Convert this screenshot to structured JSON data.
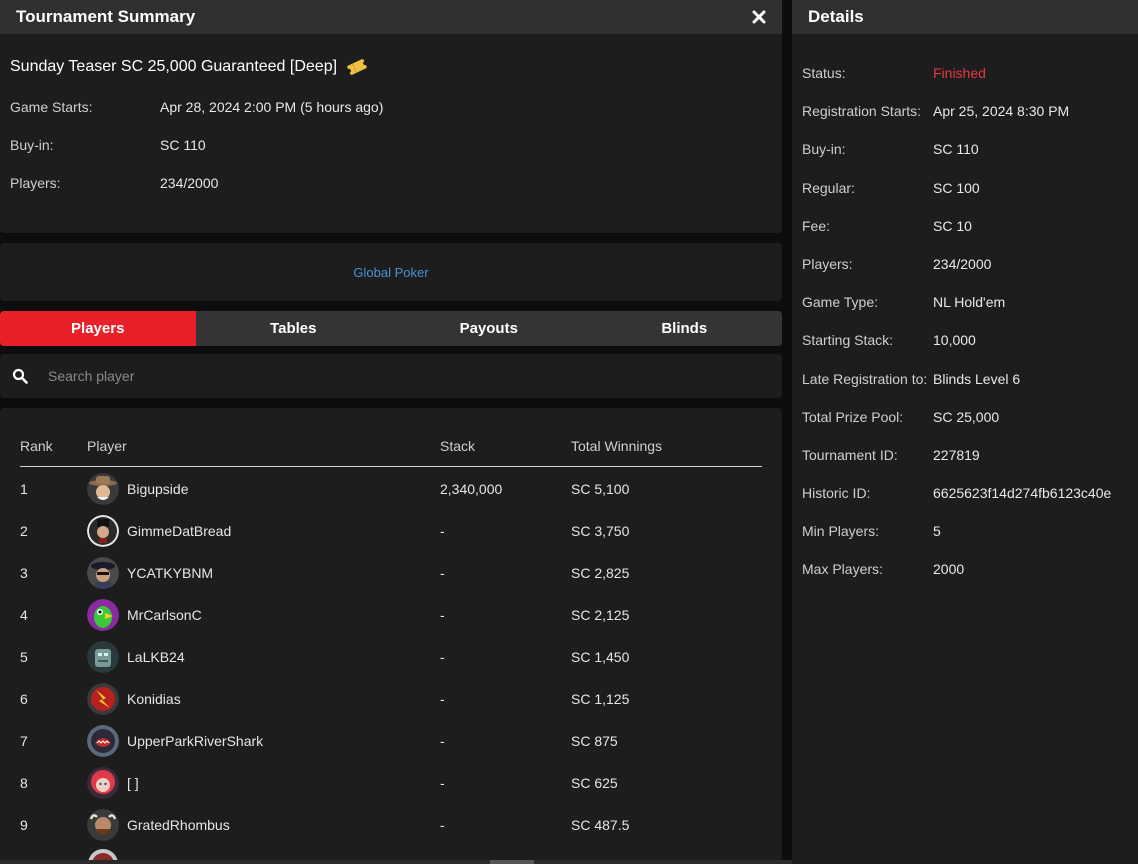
{
  "summary": {
    "title": "Tournament Summary",
    "name": "Sunday Teaser SC 25,000 Guaranteed [Deep]",
    "rows": [
      {
        "label": "Game Starts:",
        "value": "Apr 28, 2024 2:00 PM (5 hours ago)"
      },
      {
        "label": "Buy-in:",
        "value": "SC 110"
      },
      {
        "label": "Players:",
        "value": "234/2000"
      }
    ]
  },
  "site": {
    "link": "Global Poker"
  },
  "tabs": [
    {
      "label": "Players",
      "active": true
    },
    {
      "label": "Tables",
      "active": false
    },
    {
      "label": "Payouts",
      "active": false
    },
    {
      "label": "Blinds",
      "active": false
    }
  ],
  "search": {
    "placeholder": "Search player"
  },
  "table": {
    "headers": {
      "rank": "Rank",
      "player": "Player",
      "stack": "Stack",
      "winnings": "Total Winnings"
    },
    "rows": [
      {
        "rank": "1",
        "player": "Bigupside",
        "stack": "2,340,000",
        "winnings": "SC 5,100",
        "avatar": "cowboy-avatar"
      },
      {
        "rank": "2",
        "player": "GimmeDatBread",
        "stack": "-",
        "winnings": "SC 3,750",
        "avatar": "gentleman-avatar"
      },
      {
        "rank": "3",
        "player": "YCATKYBNM",
        "stack": "-",
        "winnings": "SC 2,825",
        "avatar": "gangster-avatar"
      },
      {
        "rank": "4",
        "player": "MrCarlsonC",
        "stack": "-",
        "winnings": "SC 2,125",
        "avatar": "parrot-avatar"
      },
      {
        "rank": "5",
        "player": "LaLKB24",
        "stack": "-",
        "winnings": "SC 1,450",
        "avatar": "robot-avatar"
      },
      {
        "rank": "6",
        "player": "Konidias",
        "stack": "-",
        "winnings": "SC 1,125",
        "avatar": "lightning-avatar"
      },
      {
        "rank": "7",
        "player": "UpperParkRiverShark",
        "stack": "-",
        "winnings": "SC 875",
        "avatar": "shark-avatar"
      },
      {
        "rank": "8",
        "player": "[ ]",
        "stack": "-",
        "winnings": "SC 625",
        "avatar": "redhead-avatar"
      },
      {
        "rank": "9",
        "player": "GratedRhombus",
        "stack": "-",
        "winnings": "SC 487.5",
        "avatar": "viking-avatar"
      }
    ]
  },
  "details": {
    "title": "Details",
    "rows": [
      {
        "label": "Status:",
        "value": "Finished"
      },
      {
        "label": "Registration Starts:",
        "value": "Apr 25, 2024 8:30 PM"
      },
      {
        "label": "Buy-in:",
        "value": "SC 110"
      },
      {
        "label": "Regular:",
        "value": "SC 100"
      },
      {
        "label": "Fee:",
        "value": "SC 10"
      },
      {
        "label": "Players:",
        "value": "234/2000"
      },
      {
        "label": "Game Type:",
        "value": "NL Hold'em"
      },
      {
        "label": "Starting Stack:",
        "value": "10,000"
      },
      {
        "label": "Late Registration to:",
        "value": "Blinds Level 6"
      },
      {
        "label": "Total Prize Pool:",
        "value": "SC 25,000"
      },
      {
        "label": "Tournament ID:",
        "value": "227819"
      },
      {
        "label": "Historic ID:",
        "value": "6625623f14d274fb6123c40e"
      },
      {
        "label": "Min Players:",
        "value": "5"
      },
      {
        "label": "Max Players:",
        "value": "2000"
      }
    ]
  },
  "colors": {
    "accent": "#e8202a",
    "status_finished": "#e8393e",
    "link": "#4a90d9"
  }
}
